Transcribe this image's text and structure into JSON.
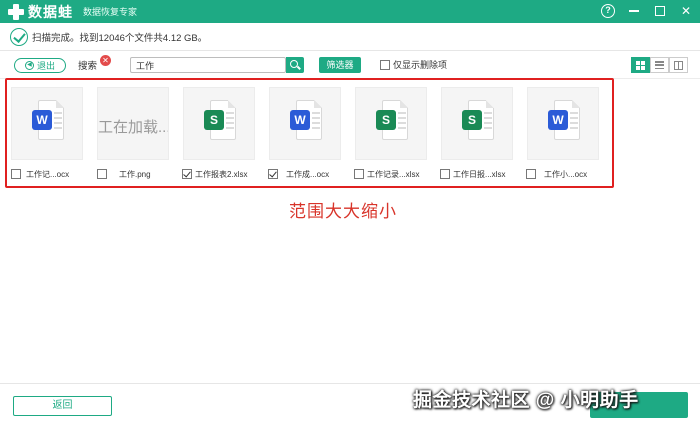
{
  "app": {
    "name": "数据蛙",
    "subtitle": "数据恢复专家",
    "help_symbol": "?",
    "close_symbol": "✕"
  },
  "status": {
    "text": "扫描完成。找到12046个文件共4.12 GB。"
  },
  "toolbar": {
    "back_label": "退出",
    "search_label": "搜索",
    "clear_symbol": "✕",
    "search_value": "工作",
    "filter_label": "筛选器",
    "only_deleted_label": "仅显示删除项",
    "only_deleted_checked": false,
    "view_modes": [
      "grid",
      "list",
      "columns"
    ],
    "active_view": "grid"
  },
  "files": [
    {
      "name": "工作记...ocx",
      "type": "word",
      "checked": false
    },
    {
      "name": "工作.png",
      "type": "image",
      "preview_text": "工在加载...",
      "checked": false
    },
    {
      "name": "工作报表2.xlsx",
      "type": "excel",
      "checked": true
    },
    {
      "name": "工作成...ocx",
      "type": "word",
      "checked": true
    },
    {
      "name": "工作记录...xlsx",
      "type": "excel",
      "checked": false
    },
    {
      "name": "工作日报...xlsx",
      "type": "excel",
      "checked": false
    },
    {
      "name": "工作小...ocx",
      "type": "word",
      "checked": false
    }
  ],
  "badges": {
    "word": "W",
    "excel": "S"
  },
  "caption": "范围大大缩小",
  "footer": {
    "back_label": "返回",
    "watermark": "掘金技术社区 @ 小明助手"
  },
  "colors": {
    "brand": "#1eaa84",
    "highlight": "#e02020",
    "word": "#2b5bd7",
    "excel": "#1a8a55"
  }
}
